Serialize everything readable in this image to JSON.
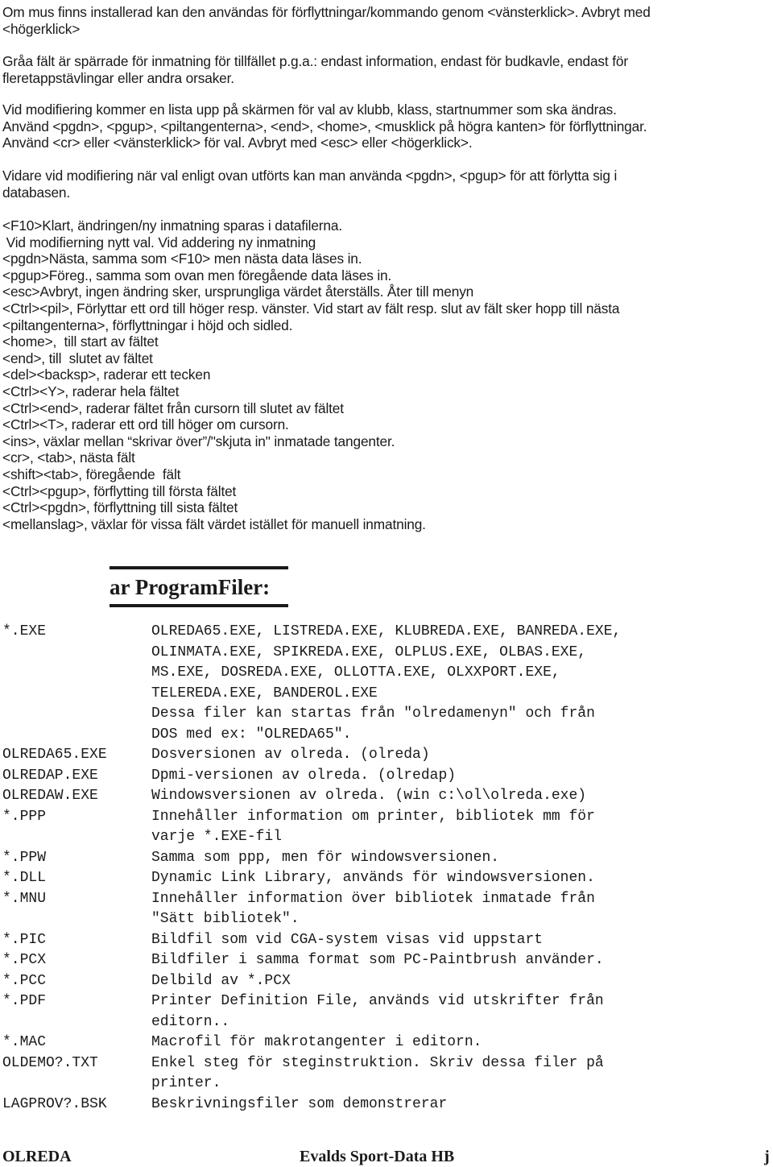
{
  "intro": {
    "mouse_lines": [
      "Om mus finns installerad kan den användas för förflyttningar/kommando genom <vänsterklick>. Avbryt med",
      "<högerklick>"
    ],
    "grey_lines": [
      "Gråa fält är spärrade för inmatning för tillfället p.g.a.: endast information, endast för budkavle, endast för",
      "fleretappstävlingar eller andra orsaker."
    ],
    "modify_lines": [
      "Vid modifiering kommer en lista upp på skärmen för val av klubb, klass, startnummer som ska ändras.",
      "Använd <pgdn>, <pgup>, <piltangenterna>, <end>, <home>, <musklick på högra kanten> för förflyttningar.",
      "Använd <cr> eller <vänsterklick> för val. Avbryt med <esc> eller <högerklick>."
    ],
    "further_lines": [
      "Vidare vid modifiering när val enligt ovan utförts kan man använda <pgdn>, <pgup> för att förlytta sig i",
      "databasen."
    ]
  },
  "keys": [
    "<F10>Klart, ändringen/ny inmatning sparas i datafilerna.",
    " Vid modifierning nytt val. Vid addering ny inmatning",
    "<pgdn>Nästa, samma som <F10> men nästa data läses in.",
    "<pgup>Föreg., samma som ovan men föregående data läses in.",
    "<esc>Avbryt, ingen ändring sker, ursprungliga värdet återställs. Åter till menyn",
    "<Ctrl><pil>, Förlyttar ett ord till höger resp. vänster. Vid start av fält resp. slut av fält sker hopp till nästa",
    "<piltangenterna>, förflyttningar i höjd och sidled.",
    "<home>,  till start av fältet",
    "<end>, till  slutet av fältet",
    "<del><backsp>, raderar ett tecken",
    "<Ctrl><Y>, raderar hela fältet",
    "<Ctrl><end>, raderar fältet från cursorn till slutet av fältet",
    "<Ctrl><T>, raderar ett ord till höger om cursorn.",
    "<ins>, växlar mellan “skrivar över”/\"skjuta in\" inmatade tangenter.",
    "<cr>, <tab>, nästa fält",
    "<shift><tab>, föregående  fält",
    "<Ctrl><pgup>, förflytting till första fältet",
    "<Ctrl><pgdn>, förflyttning till sista fältet",
    "<mellanslag>, växlar för vissa fält värdet istället för manuell inmatning."
  ],
  "section_heading": "ar ProgramFiler:",
  "files": [
    {
      "name": "*.EXE",
      "lines": [
        "OLREDA65.EXE, LISTREDA.EXE, KLUBREDA.EXE, BANREDA.EXE,",
        "OLINMATA.EXE, SPIKREDA.EXE, OLPLUS.EXE, OLBAS.EXE,",
        "MS.EXE, DOSREDA.EXE, OLLOTTA.EXE, OLXXPORT.EXE,",
        "TELEREDA.EXE, BANDEROL.EXE",
        "Dessa filer kan startas från ″olredamenyn″ och från",
        "DOS med ex: ″OLREDA65\"."
      ]
    },
    {
      "name": "OLREDA65.EXE",
      "lines": [
        "Dosversionen av olreda. (olreda)"
      ]
    },
    {
      "name": "OLREDAP.EXE",
      "lines": [
        "Dpmi-versionen av olreda. (olredap)"
      ]
    },
    {
      "name": "OLREDAW.EXE",
      "lines": [
        "Windowsversionen av olreda. (win c:\\ol\\olreda.exe)"
      ]
    },
    {
      "name": "*.PPP",
      "lines": [
        "Innehåller information om printer, bibliotek mm för",
        "varje *.EXE-fil"
      ]
    },
    {
      "name": "*.PPW",
      "lines": [
        "Samma som ppp, men för windowsversionen."
      ]
    },
    {
      "name": "*.DLL",
      "lines": [
        "Dynamic Link Library, används för windowsversionen."
      ]
    },
    {
      "name": "*.MNU",
      "lines": [
        "Innehåller information över bibliotek inmatade från",
        "″Sätt bibliotek\"."
      ]
    },
    {
      "name": "*.PIC",
      "lines": [
        "Bildfil som vid CGA-system visas vid uppstart"
      ]
    },
    {
      "name": "*.PCX",
      "lines": [
        "Bildfiler i samma format som PC-Paintbrush använder."
      ]
    },
    {
      "name": "*.PCC",
      "lines": [
        "Delbild av *.PCX"
      ]
    },
    {
      "name": "*.PDF",
      "lines": [
        "Printer Definition File, används vid utskrifter från",
        "editorn.."
      ]
    },
    {
      "name": "*.MAC",
      "lines": [
        "Macrofil för makrotangenter i editorn."
      ]
    },
    {
      "name": "OLDEMO?.TXT",
      "lines": [
        "Enkel steg för steginstruktion. Skriv dessa filer på",
        "printer."
      ]
    },
    {
      "name": "LAGPROV?.BSK",
      "lines": [
        "Beskrivningsfiler som demonstrerar"
      ]
    }
  ],
  "footer": {
    "left": "OLREDA",
    "center": "Evalds Sport-Data HB",
    "right": "j"
  }
}
